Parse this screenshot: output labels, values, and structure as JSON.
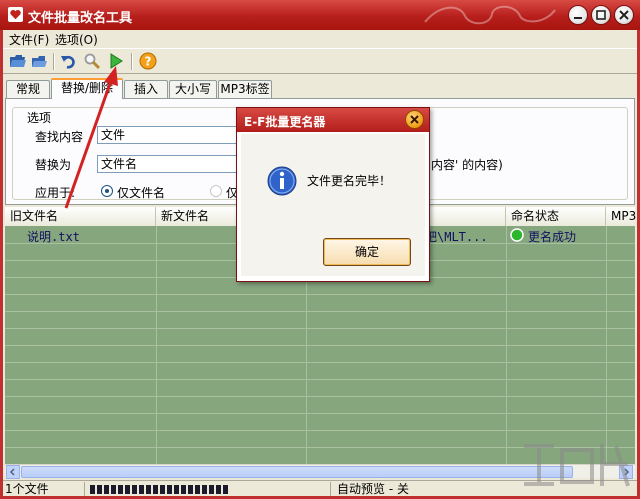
{
  "window": {
    "title": "文件批量改名工具"
  },
  "menu": {
    "file": "文件(F)",
    "options": "选项(O)"
  },
  "tabs": [
    {
      "label": "常规"
    },
    {
      "label": "替换/删除"
    },
    {
      "label": "插入"
    },
    {
      "label": "大小写"
    },
    {
      "label": "MP3标签"
    }
  ],
  "options_panel": {
    "legend": "选项",
    "find_label": "查找内容",
    "find_value": "文件",
    "replace_label": "替换为",
    "replace_value": "文件名",
    "hint_text": "内容' 的内容)",
    "apply_label": "应用于:",
    "radio_filename_only": "仅文件名",
    "radio_other": "仅"
  },
  "list": {
    "columns": [
      "旧文件名",
      "新文件名",
      "",
      "命名状态",
      "MP3"
    ],
    "rows": [
      {
        "old_name": "说明.txt",
        "new_name": "",
        "path": "吧\\MLT...",
        "status": "更名成功"
      }
    ]
  },
  "statusbar": {
    "count": "1个文件",
    "preview": "自动预览 - 关"
  },
  "dialog": {
    "title": "E-F批量更名器",
    "message": "文件更名完毕！",
    "ok_label": "确定"
  },
  "colors": {
    "titlebar": "#b71f1c",
    "list_bg": "#86a67e",
    "status_ok": "#2db52d"
  }
}
